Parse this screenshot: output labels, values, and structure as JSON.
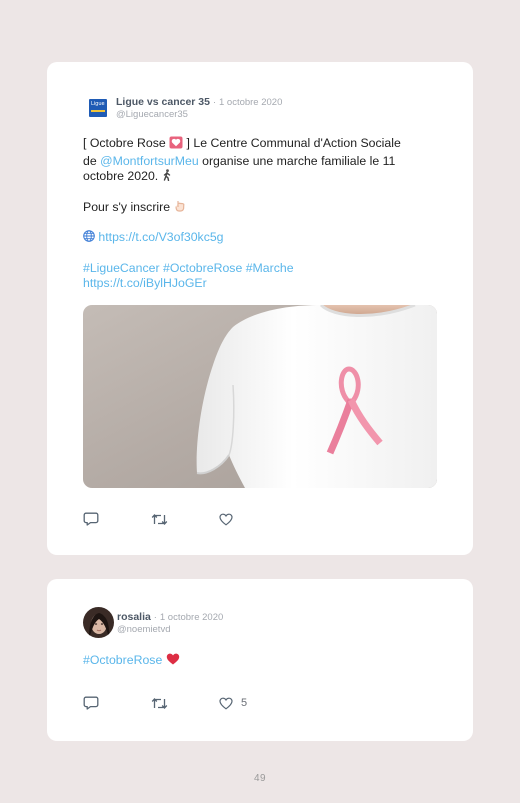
{
  "tweets": [
    {
      "author": "Ligue vs cancer 35",
      "separator": "·",
      "date": "1 octobre 2020",
      "handle": "@Liguecancer35",
      "text_line1_pre": "[ Octobre Rose",
      "text_line1_post": "] Le Centre Communal d'Action Sociale",
      "text_line2_pre": "de",
      "mention": "@MontfortsurMeu",
      "text_line2_post": "organise une marche familiale le 11",
      "text_line3": "octobre 2020.",
      "register_text": "Pour s'y inscrire",
      "link1": "https://t.co/V3of30kc5g",
      "hashtags": [
        "#LigueCancer",
        "#OctobreRose",
        "#Marche"
      ],
      "link2": "https://t.co/iBylHJoGEr",
      "has_image": true
    },
    {
      "author": "rosalia",
      "separator": "·",
      "date": "1 octobre 2020",
      "handle": "@noemietvd",
      "hashtag": "#OctobreRose",
      "like_count": "5"
    }
  ],
  "page_number": "49",
  "colors": {
    "link": "#5ab6ea",
    "background": "#ede6e6",
    "heart": "#e0245e"
  },
  "icons": [
    "reply-icon",
    "retweet-icon",
    "like-icon",
    "globe-icon",
    "heart-emoji",
    "walking-person-emoji",
    "pointing-hand-emoji"
  ]
}
